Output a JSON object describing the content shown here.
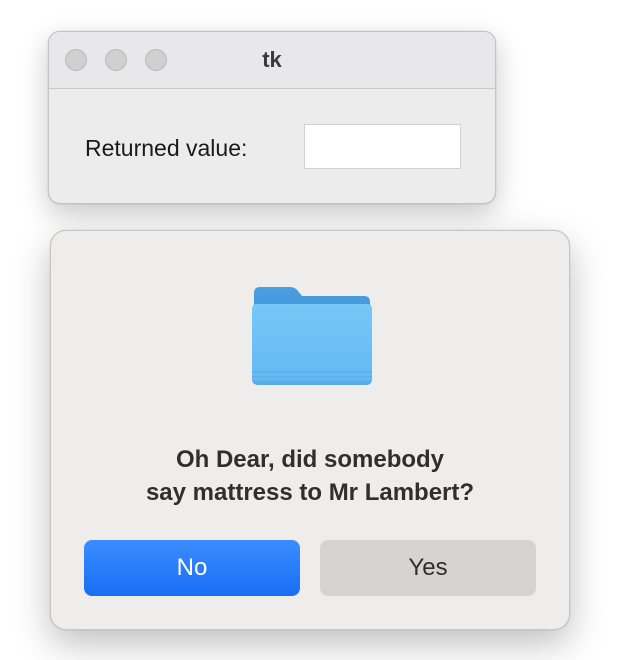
{
  "main_window": {
    "title": "tk",
    "returned_value_label": "Returned value:",
    "returned_value": ""
  },
  "dialog": {
    "icon": "folder-icon",
    "message_line1": "Oh Dear, did somebody",
    "message_line2": "say mattress to Mr Lambert?",
    "no_label": "No",
    "yes_label": "Yes"
  },
  "colors": {
    "accent_button": "#1a6ef5",
    "dialog_background": "#efedeb",
    "folder_blue": "#6dc3f7"
  }
}
